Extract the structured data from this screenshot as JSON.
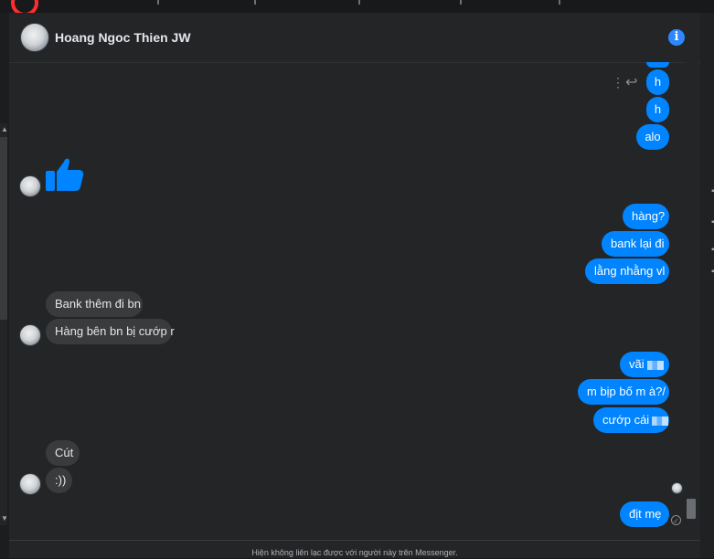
{
  "header": {
    "contact_name": "Hoang Ngoc Thien JW",
    "info_icon": "info-icon",
    "accent_color": "#2d88ff"
  },
  "messages": [
    {
      "from": "me",
      "text": "h"
    },
    {
      "from": "me",
      "text": "h"
    },
    {
      "from": "me",
      "text": "alo"
    },
    {
      "from": "them",
      "text": "",
      "sticker": "thumbs-up-icon"
    },
    {
      "from": "me",
      "text": "hàng?"
    },
    {
      "from": "me",
      "text": "bank lại đi"
    },
    {
      "from": "me",
      "text": "lằng nhằng vl"
    },
    {
      "from": "them",
      "text": "Bank thêm đi bn"
    },
    {
      "from": "them",
      "text": "Hàng bên bn bị cướp r"
    },
    {
      "from": "me",
      "text": "vãi"
    },
    {
      "from": "me",
      "text": "m bịp bố m à?/"
    },
    {
      "from": "me",
      "text": "cướp cái"
    },
    {
      "from": "them",
      "text": "Cút"
    },
    {
      "from": "them",
      "text": ":))"
    },
    {
      "from": "me",
      "text": "địt mẹ"
    }
  ],
  "message_actions": {
    "more_icon": "more-vertical-icon",
    "reply_icon": "reply-icon"
  },
  "footer": {
    "notice": "Hiện không liên lạc được với người này trên Messenger."
  },
  "colors": {
    "outgoing_bubble": "#0084ff",
    "incoming_bubble": "#3a3b3c",
    "background": "#242526"
  }
}
